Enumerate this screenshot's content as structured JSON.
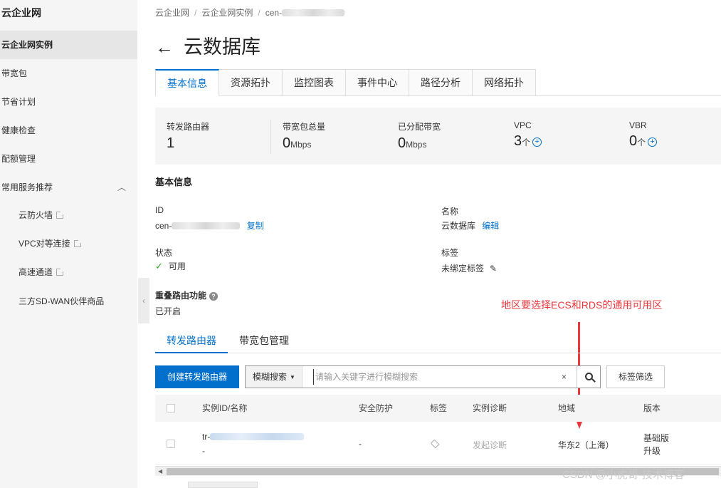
{
  "sidebar": {
    "title": "云企业网",
    "items": [
      {
        "label": "云企业网实例",
        "active": true
      },
      {
        "label": "带宽包"
      },
      {
        "label": "节省计划"
      },
      {
        "label": "健康检查"
      },
      {
        "label": "配额管理"
      },
      {
        "label": "常用服务推荐"
      }
    ],
    "sub_items": [
      {
        "label": "云防火墙"
      },
      {
        "label": "VPC对等连接"
      },
      {
        "label": "高速通道"
      },
      {
        "label": "三方SD-WAN伙伴商品"
      }
    ]
  },
  "breadcrumb": [
    "云企业网",
    "云企业网实例",
    "cen-"
  ],
  "page_title": "云数据库",
  "tabs": [
    "基本信息",
    "资源拓扑",
    "监控图表",
    "事件中心",
    "路径分析",
    "网络拓扑"
  ],
  "stats": [
    {
      "label": "转发路由器",
      "value": "1",
      "unit": ""
    },
    {
      "label": "带宽包总量",
      "value": "0",
      "unit": "Mbps"
    },
    {
      "label": "已分配带宽",
      "value": "0",
      "unit": "Mbps"
    },
    {
      "label": "VPC",
      "value": "3",
      "unit": "个"
    },
    {
      "label": "VBR",
      "value": "0",
      "unit": "个"
    }
  ],
  "basic_info": {
    "title": "基本信息",
    "id_label": "ID",
    "id_value": "cen-",
    "copy_link": "复制",
    "name_label": "名称",
    "name_value": "云数据库",
    "edit_link": "编辑",
    "status_label": "状态",
    "status_value": "可用",
    "tag_label": "标签",
    "tag_value": "未绑定标签",
    "overlap_label": "重叠路由功能",
    "overlap_value": "已开启"
  },
  "annotation": "地区要选择ECS和RDS的通用可用区",
  "subtabs": [
    "转发路由器",
    "带宽包管理"
  ],
  "toolbar": {
    "create_button": "创建转发路由器",
    "search_mode": "模糊搜索",
    "search_placeholder": "请输入关键字进行模糊搜索",
    "clear": "×",
    "tag_filter": "标签筛选"
  },
  "table": {
    "columns": [
      "实例ID/名称",
      "安全防护",
      "标签",
      "实例诊断",
      "地域",
      "版本"
    ],
    "rows": [
      {
        "id": "tr-",
        "name": "-",
        "security": "-",
        "diagnose": "发起诊断",
        "region": "华东2（上海）",
        "edition": "基础版",
        "upgrade": "升级"
      }
    ]
  },
  "watermark": "CSDN @小虎哥-技术博客",
  "colors": {
    "accent": "#0070cc",
    "annotation": "#e8383d",
    "success": "#2ea121"
  }
}
